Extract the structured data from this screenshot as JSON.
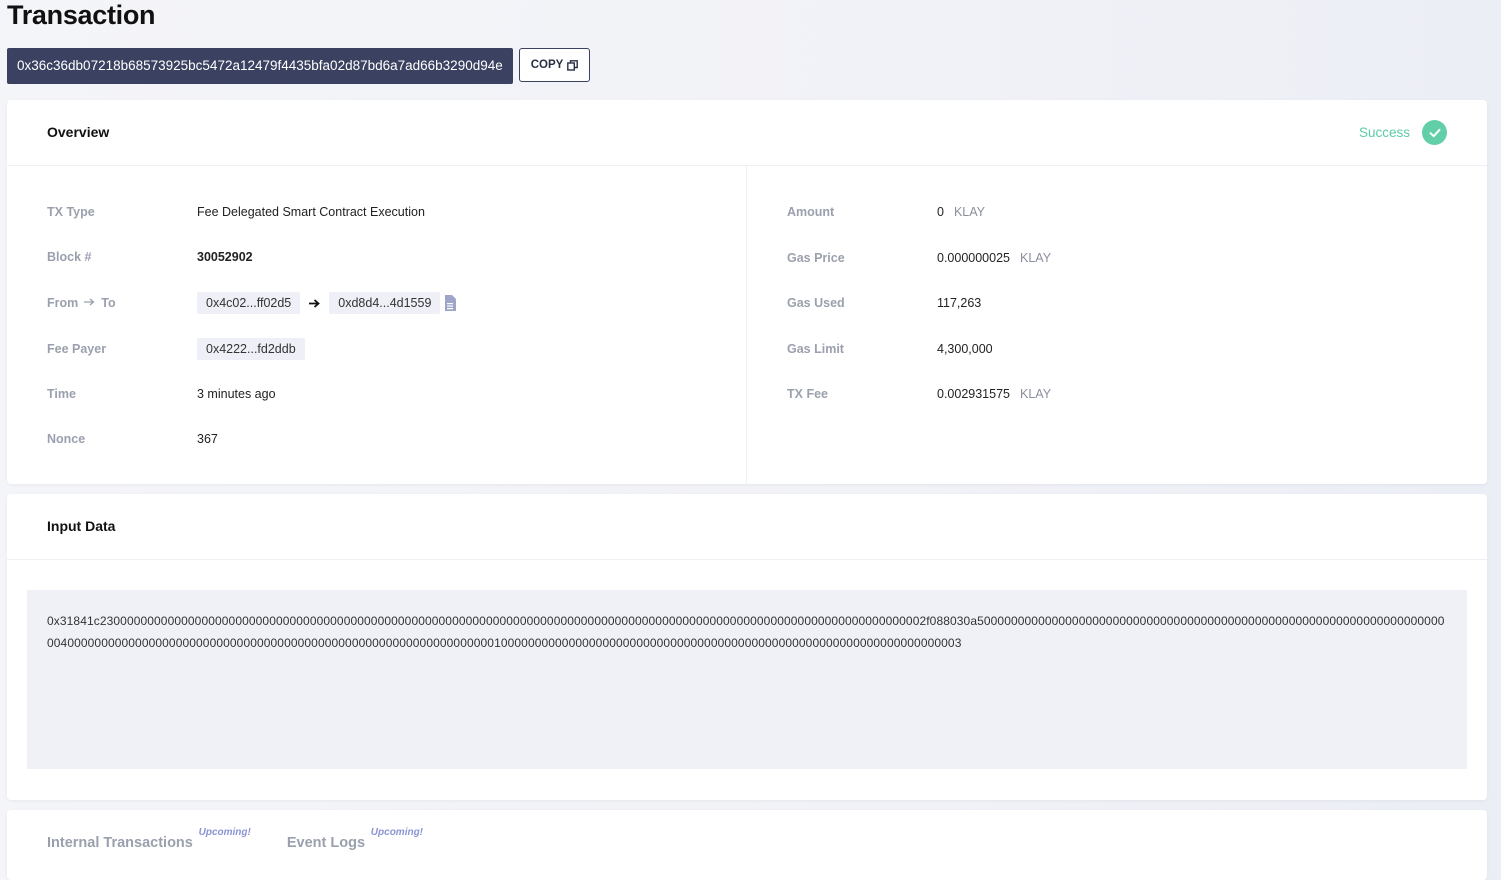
{
  "page": {
    "title": "Transaction"
  },
  "tx": {
    "hash": "0x36c36db07218b68573925bc5472a12479f4435bfa02d87bd6a7ad66b3290d94e",
    "copy_label": "COPY"
  },
  "overview": {
    "title": "Overview",
    "status": "Success",
    "status_color": "#5dcba6",
    "left": {
      "tx_type_label": "TX Type",
      "tx_type": "Fee Delegated Smart Contract Execution",
      "block_label": "Block #",
      "block": "30052902",
      "from_label": "From",
      "to_label": "To",
      "from": "0x4c02...ff02d5",
      "to": "0xd8d4...4d1559",
      "fee_payer_label": "Fee Payer",
      "fee_payer": "0x4222...fd2ddb",
      "time_label": "Time",
      "time": "3 minutes ago",
      "nonce_label": "Nonce",
      "nonce": "367"
    },
    "right": {
      "amount_label": "Amount",
      "amount": "0",
      "amount_unit": "KLAY",
      "gas_price_label": "Gas Price",
      "gas_price": "0.000000025",
      "gas_price_unit": "KLAY",
      "gas_used_label": "Gas Used",
      "gas_used": "117,263",
      "gas_limit_label": "Gas Limit",
      "gas_limit": "4,300,000",
      "tx_fee_label": "TX Fee",
      "tx_fee": "0.002931575",
      "tx_fee_unit": "KLAY"
    }
  },
  "input_data": {
    "title": "Input Data",
    "value": "0x31841c23000000000000000000000000000000000000000000000000000000000000000000000000000000000000000000000000000000000000000000000002f088030a500000000000000000000000000000000000000000000000000000000000000000000004000000000000000000000000000000000000000000000000000000000000000100000000000000000000000000000000000000000000000000000000000000000003"
  },
  "tabs": [
    {
      "label": "Internal Transactions",
      "badge": "Upcoming!"
    },
    {
      "label": "Event Logs",
      "badge": "Upcoming!"
    }
  ]
}
